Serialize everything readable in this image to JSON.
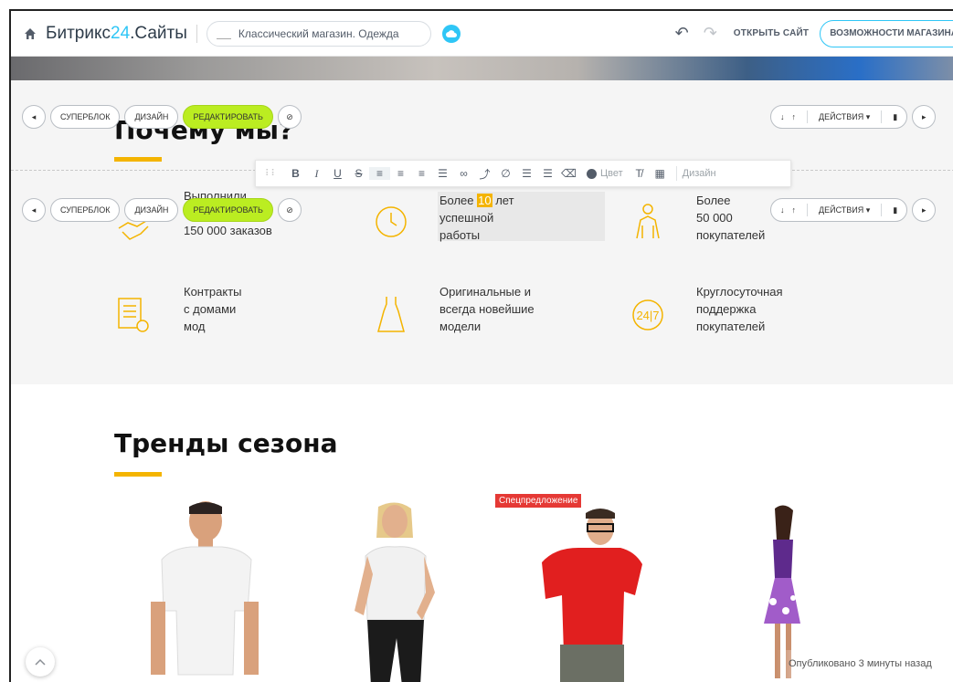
{
  "topbar": {
    "brand_prefix": "Битрикс",
    "brand_num": "24",
    "brand_suffix": ".Сайты",
    "site_name": "Классический магазин. Одежда",
    "open_site": "ОТКРЫТЬ САЙТ",
    "shop_features": "ВОЗМОЖНОСТИ МАГАЗИНА",
    "icons": [
      "home-icon",
      "cloud-icon",
      "undo-icon",
      "redo-icon"
    ]
  },
  "block_controls": {
    "superblock": "СУПЕРБЛОК",
    "design": "ДИЗАЙН",
    "edit": "РЕДАКТИРОВАТЬ",
    "actions": "ДЕЙСТВИЯ",
    "icons": [
      "arrow-left-icon",
      "hide-icon",
      "arrow-down-icon",
      "arrow-up-icon",
      "trash-icon",
      "arrow-right-icon"
    ]
  },
  "editor_toolbar": {
    "buttons": [
      "B",
      "I",
      "U",
      "S"
    ],
    "color_label": "Цвет",
    "design_label": "Дизайн"
  },
  "why_us": {
    "title": "Почему мы?",
    "features": [
      {
        "line1": "Выполнили",
        "line2": "",
        "line3": "150 000 заказов",
        "icon": "handshake-icon"
      },
      {
        "line1_pre": "Более ",
        "line1_hl": "10",
        "line1_post": " лет",
        "line2": "успешной",
        "line3": "работы",
        "icon": "clock-icon"
      },
      {
        "line1": "Более",
        "line2": "50 000",
        "line3": "покупателей",
        "icon": "person-icon"
      },
      {
        "line1": "Контракты",
        "line2": "с домами",
        "line3": "мод",
        "icon": "document-icon"
      },
      {
        "line1": "Оригинальные и",
        "line2": "всегда новейшие",
        "line3": "модели",
        "icon": "dress-icon"
      },
      {
        "line1": "Круглосуточная",
        "line2": "поддержка",
        "line3": "покупателей",
        "icon": "support-24-7-icon"
      }
    ],
    "support_icon_text": "24|7"
  },
  "trends": {
    "title": "Тренды сезона",
    "badge": "Спецпредложение"
  },
  "status": {
    "published": "Опубликовано 3 минуты назад"
  },
  "colors": {
    "accent": "#2fc6f6",
    "edit_button": "#bbed21",
    "highlight": "#f4b400",
    "badge": "#e53935"
  }
}
